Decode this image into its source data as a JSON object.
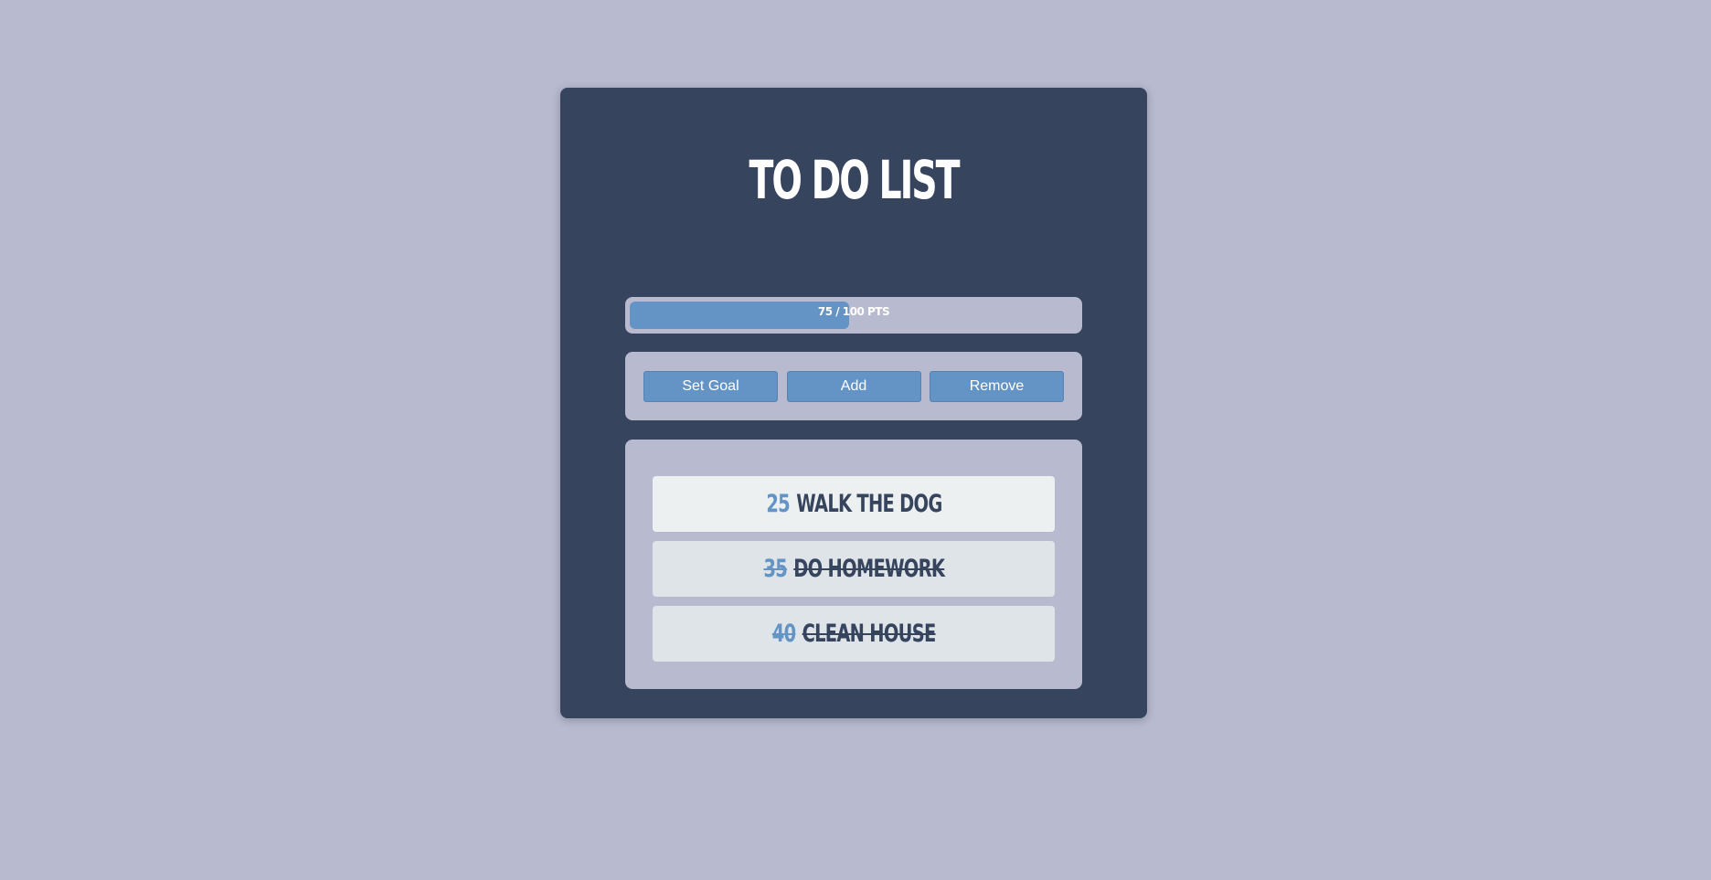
{
  "app": {
    "title": "TO DO LIST"
  },
  "progress": {
    "label": "75 / 100 PTS",
    "current": 75,
    "goal": 100,
    "fraction": 0.75
  },
  "actions": {
    "set_goal_label": "Set Goal",
    "add_label": "Add",
    "remove_label": "Remove"
  },
  "tasks": [
    {
      "points": "25",
      "name": "WALK THE DOG",
      "done": false
    },
    {
      "points": "35",
      "name": "DO HOMEWORK",
      "done": true
    },
    {
      "points": "40",
      "name": "CLEAN HOUSE",
      "done": true
    }
  ],
  "colors": {
    "background": "#b8bbd0",
    "card": "#36445e",
    "accent": "#6394c5",
    "task_active": "#edf0f1",
    "task_done": "#dfe4e9"
  }
}
